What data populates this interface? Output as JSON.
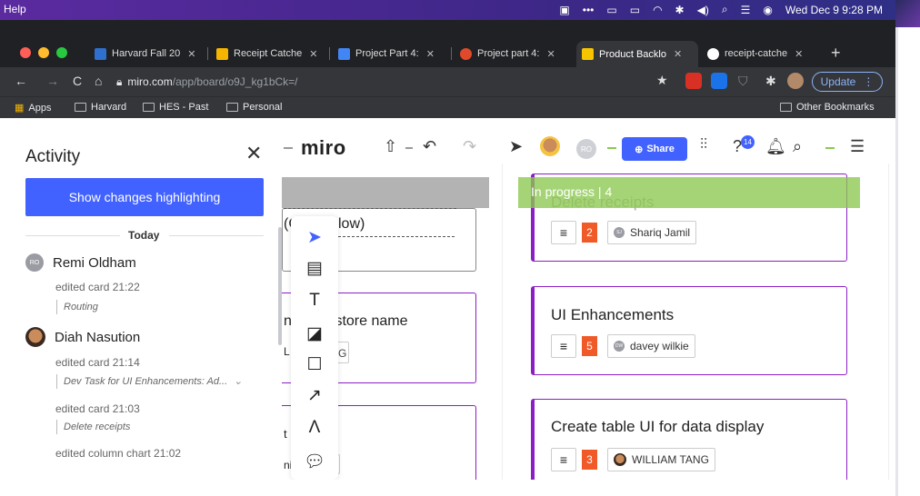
{
  "menubar": {
    "app_menu": "Help",
    "datetime": "Wed Dec 9  9:28 PM"
  },
  "browser": {
    "tabs": [
      {
        "label": "Harvard Fall 20",
        "favicon_color": "#2f6fce"
      },
      {
        "label": "Receipt Catche",
        "favicon_color": "#f5b400"
      },
      {
        "label": "Project Part 4:",
        "favicon_color": "#4285f4"
      },
      {
        "label": "Project part 4:",
        "favicon_color": "#e04a2a"
      },
      {
        "label": "Product Backlo",
        "favicon_color": "#f7c500",
        "active": true
      },
      {
        "label": "receipt-catche",
        "favicon_color": "#ffffff"
      }
    ],
    "url_host": "miro.com",
    "url_path": "/app/board/o9J_kg1bCk=/",
    "update_label": "Update",
    "bookmarks": [
      "Apps",
      "Harvard",
      "HES - Past",
      "Personal"
    ],
    "other_bookmarks": "Other Bookmarks"
  },
  "activity": {
    "title": "Activity",
    "highlight_button": "Show changes highlighting",
    "section_label": "Today",
    "entries": [
      {
        "user": "Remi Oldham",
        "initials": "RO",
        "action": "edited card  21:22",
        "detail": "Routing"
      },
      {
        "user": "Diah Nasution",
        "action": "edited card  21:14",
        "detail": "Dev Task for UI Enhancements: Ad...",
        "action2": "edited card  21:03",
        "detail2": "Delete receipts",
        "action3": "edited column chart  21:02"
      }
    ]
  },
  "miro": {
    "logo": "miro",
    "share_label": "Share",
    "notifications_count": "14",
    "collaborator_initials": "RO"
  },
  "board": {
    "left_fragments": [
      "(C",
      "low)",
      "n",
      "/store name",
      "L",
      "G",
      "t",
      "ni",
      "i"
    ],
    "column_label": "In progress  |  4",
    "cards": [
      {
        "title": "Delete receipts",
        "estimate": "2",
        "assignee": "Shariq Jamil",
        "assignee_initials": "SJ"
      },
      {
        "title": "UI Enhancements",
        "estimate": "5",
        "assignee": "davey wilkie",
        "assignee_initials": "DW"
      },
      {
        "title": "Create table UI for data display",
        "estimate": "3",
        "assignee": "WILLIAM TANG"
      }
    ]
  },
  "colors": {
    "accent": "#4262ff",
    "card_border": "#8c1fc4",
    "estimate": "#f05a28",
    "column_header": "#8cc850"
  }
}
